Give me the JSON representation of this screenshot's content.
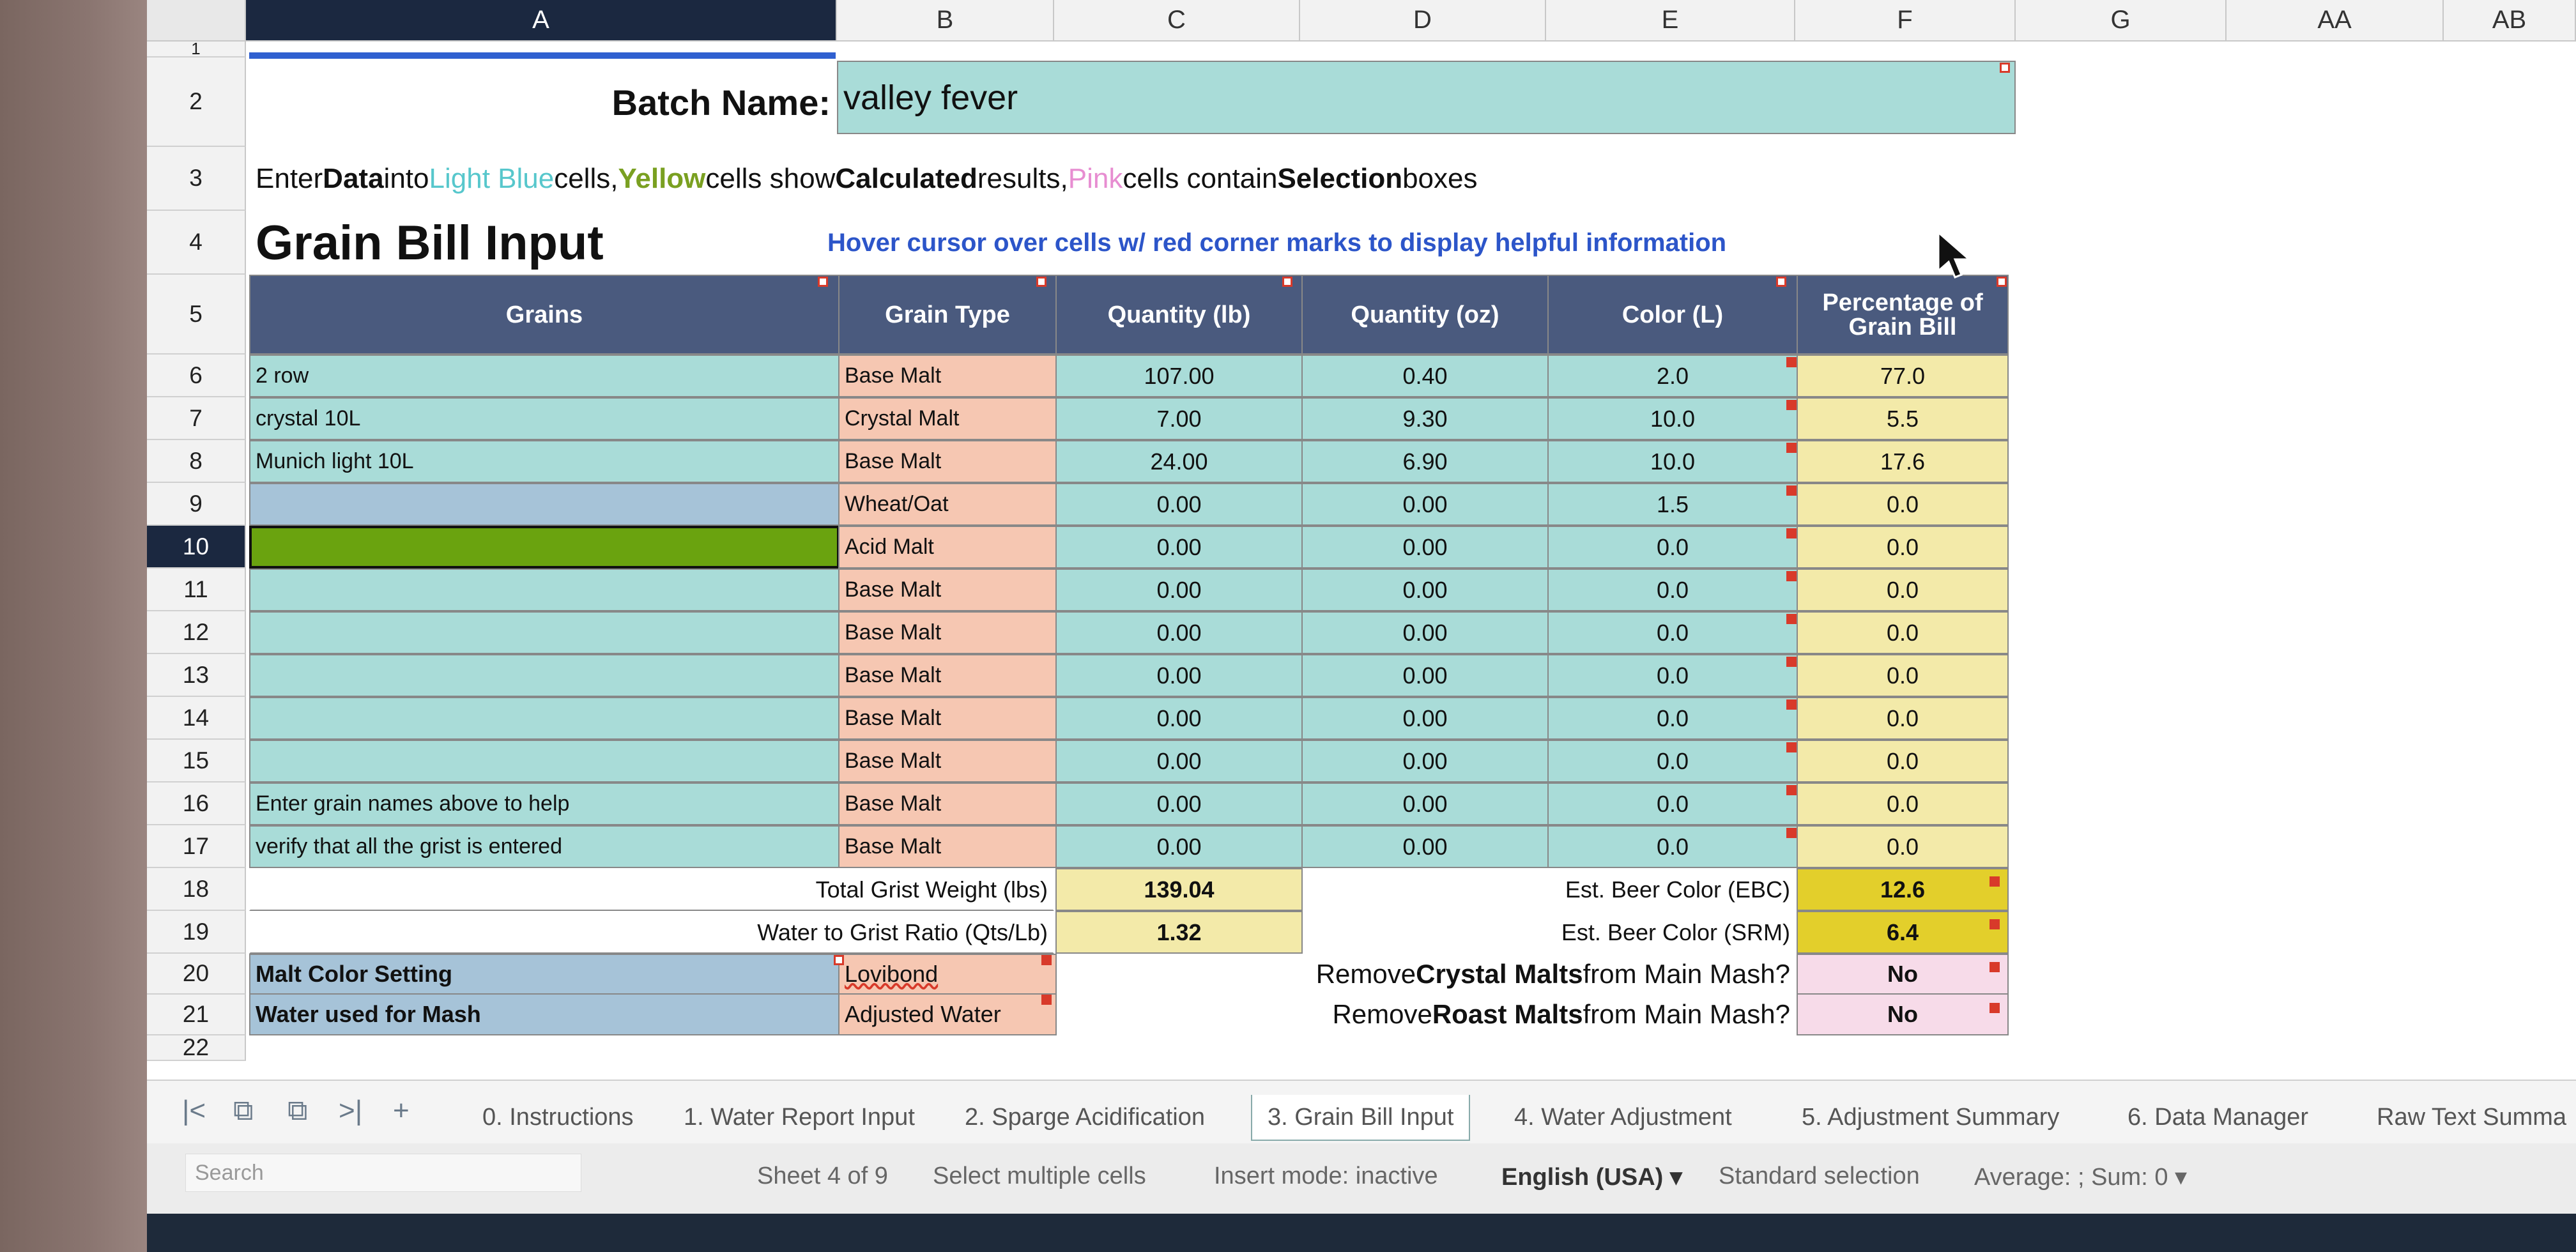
{
  "columns": [
    "A",
    "B",
    "C",
    "D",
    "E",
    "F",
    "G",
    "AA",
    "AB"
  ],
  "rows": [
    "1",
    "2",
    "3",
    "4",
    "5",
    "6",
    "7",
    "8",
    "9",
    "10",
    "11",
    "12",
    "13",
    "14",
    "15",
    "16",
    "17",
    "18",
    "19",
    "20",
    "21",
    "22"
  ],
  "batch": {
    "label": "Batch Name:",
    "value": "valley fever"
  },
  "instruction": {
    "p1": "Enter ",
    "data": "Data",
    "p2": " into ",
    "light_blue": "Light Blue",
    "p3": " cells, ",
    "yellow": "Yellow",
    "p4": " cells show ",
    "calculated": "Calculated",
    "p5": " results, ",
    "pink": "Pink",
    "p6": " cells contain ",
    "selection": "Selection",
    "p7": " boxes"
  },
  "section_title": "Grain Bill Input",
  "hover_note": "Hover cursor over cells w/ red corner marks to display helpful information",
  "table_headers": {
    "grains": "Grains",
    "grain_type": "Grain Type",
    "qty_lb": "Quantity (lb)",
    "qty_oz": "Quantity (oz)",
    "color": "Color (L)",
    "pct_1": "Percentage of",
    "pct_2": "Grain Bill"
  },
  "grain_rows": [
    {
      "name": "2 row",
      "type": "Base Malt",
      "lb": "107.00",
      "oz": "0.40",
      "color": "2.0",
      "pct": "77.0"
    },
    {
      "name": "crystal 10L",
      "type": "Crystal Malt",
      "lb": "7.00",
      "oz": "9.30",
      "color": "10.0",
      "pct": "5.5"
    },
    {
      "name": "Munich light 10L",
      "type": "Base Malt",
      "lb": "24.00",
      "oz": "6.90",
      "color": "10.0",
      "pct": "17.6"
    },
    {
      "name": "",
      "type": "Wheat/Oat",
      "lb": "0.00",
      "oz": "0.00",
      "color": "1.5",
      "pct": "0.0"
    },
    {
      "name": "",
      "type": "Acid Malt",
      "lb": "0.00",
      "oz": "0.00",
      "color": "0.0",
      "pct": "0.0"
    },
    {
      "name": "",
      "type": "Base Malt",
      "lb": "0.00",
      "oz": "0.00",
      "color": "0.0",
      "pct": "0.0"
    },
    {
      "name": "",
      "type": "Base Malt",
      "lb": "0.00",
      "oz": "0.00",
      "color": "0.0",
      "pct": "0.0"
    },
    {
      "name": "",
      "type": "Base Malt",
      "lb": "0.00",
      "oz": "0.00",
      "color": "0.0",
      "pct": "0.0"
    },
    {
      "name": "",
      "type": "Base Malt",
      "lb": "0.00",
      "oz": "0.00",
      "color": "0.0",
      "pct": "0.0"
    },
    {
      "name": "",
      "type": "Base Malt",
      "lb": "0.00",
      "oz": "0.00",
      "color": "0.0",
      "pct": "0.0"
    },
    {
      "name": "Enter grain names above to help",
      "type": "Base Malt",
      "lb": "0.00",
      "oz": "0.00",
      "color": "0.0",
      "pct": "0.0"
    },
    {
      "name": "verify that all the grist is entered",
      "type": "Base Malt",
      "lb": "0.00",
      "oz": "0.00",
      "color": "0.0",
      "pct": "0.0"
    }
  ],
  "totals": {
    "grist_label": "Total Grist Weight (lbs)",
    "grist_value": "139.04",
    "ratio_label": "Water to Grist Ratio (Qts/Lb)",
    "ratio_value": "1.32",
    "ebc_label": "Est. Beer Color (EBC)",
    "ebc_value": "12.6",
    "srm_label": "Est. Beer Color (SRM)",
    "srm_value": "6.4"
  },
  "settings": {
    "malt_color_label": "Malt Color Setting",
    "malt_color_value": "Lovibond",
    "water_label": "Water used for Mash",
    "water_value": "Adjusted Water",
    "crystal_p1": "Remove ",
    "crystal_bold": "Crystal Malts",
    "crystal_p2": " from Main Mash?",
    "crystal_value": "No",
    "roast_p1": "Remove ",
    "roast_bold": "Roast Malts",
    "roast_p2": " from Main Mash?",
    "roast_value": "No"
  },
  "tabs": [
    "0. Instructions",
    "1. Water Report Input",
    "2. Sparge Acidification",
    "3. Grain Bill Input",
    "4. Water Adjustment",
    "5. Adjustment Summary",
    "6. Data Manager",
    "Raw Text Summa"
  ],
  "status": {
    "search_placeholder": "Search",
    "sheet": "Sheet 4 of 9",
    "select": "Select multiple cells",
    "insert": "Insert mode: inactive",
    "language": "English (USA)",
    "selection_mode": "Standard selection",
    "sum": "Average: ; Sum: 0"
  },
  "colors": {
    "light_blue": "#a9dcd8",
    "pink": "#f6c7b2",
    "yellow": "#f3eaa9",
    "header": "#4a5a7e",
    "selection": "#6aa30f"
  }
}
